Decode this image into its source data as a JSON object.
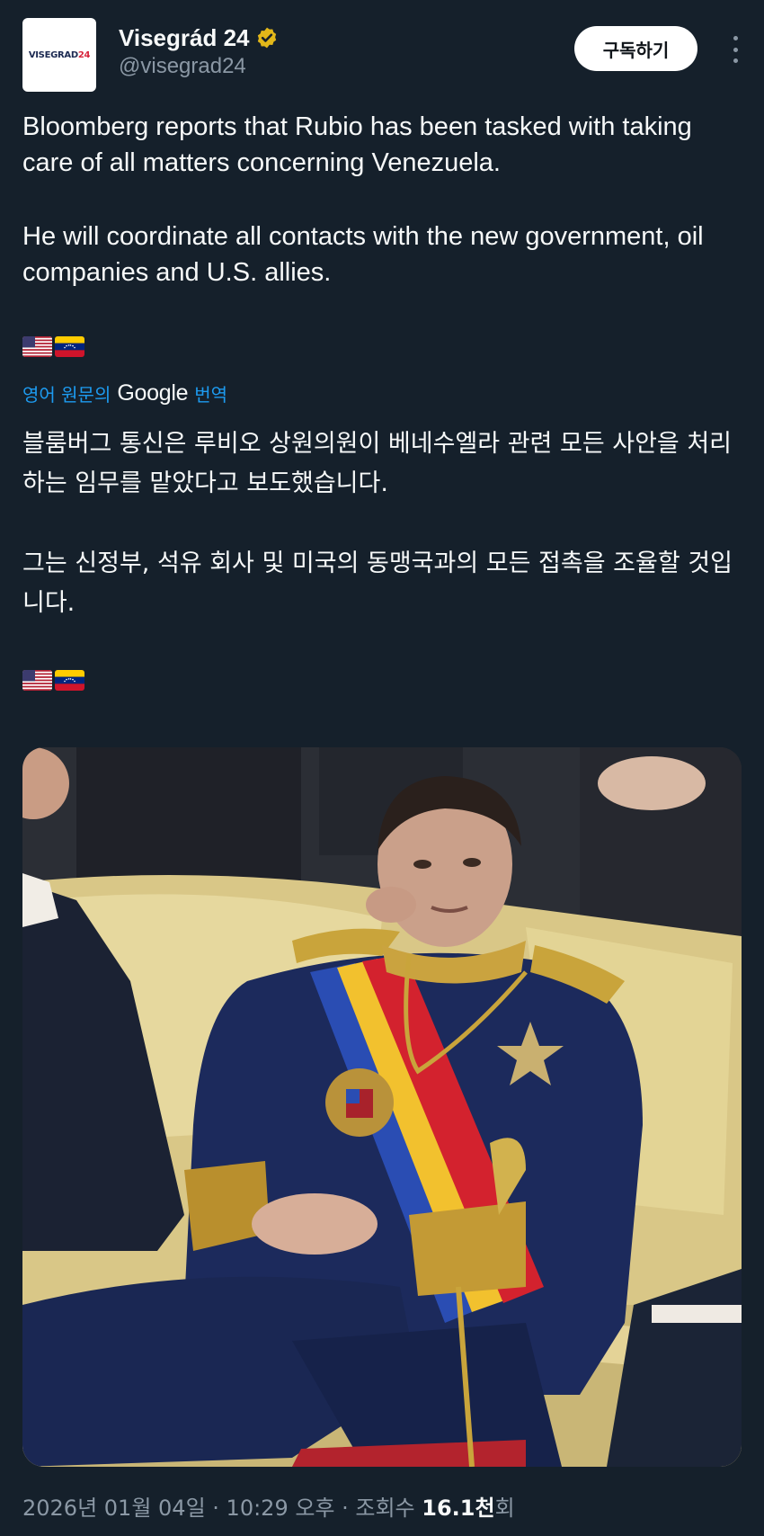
{
  "author": {
    "display_name": "Visegrád 24",
    "handle": "@visegrad24",
    "avatar_logo_main": "VISEGRAD",
    "avatar_logo_accent": "24",
    "verified": true
  },
  "header": {
    "subscribe_label": "구독하기"
  },
  "tweet": {
    "paragraph_1": "Bloomberg reports that Rubio has been tasked with taking care of all matters concerning Venezuela.",
    "paragraph_2": "He will coordinate all contacts with the new government, oil companies and U.S. allies.",
    "flags": [
      "us-flag",
      "venezuela-flag"
    ]
  },
  "translation": {
    "prefix": "영어 원문의",
    "provider": "Google",
    "suffix": "번역",
    "paragraph_1": "블룸버그 통신은 루비오 상원의원이 베네수엘라 관련 모든 사안을 처리하는 임무를 맡았다고 보도했습니다.",
    "paragraph_2": "그는 신정부, 석유 회사 및 미국의 동맹국과의 모든 접촉을 조율할 것입니다."
  },
  "meta": {
    "date": "2026년 01월 04일",
    "separator_1": " · ",
    "time": "10:29 오후",
    "separator_2": " · ",
    "views_label": "조회수 ",
    "views_count": "16.1천",
    "views_suffix": "회"
  },
  "colors": {
    "background": "#15202b",
    "text": "#f7f9f9",
    "secondary_text": "#8b98a5",
    "link": "#1d9bf0",
    "verified_badge": "#e2b719"
  }
}
